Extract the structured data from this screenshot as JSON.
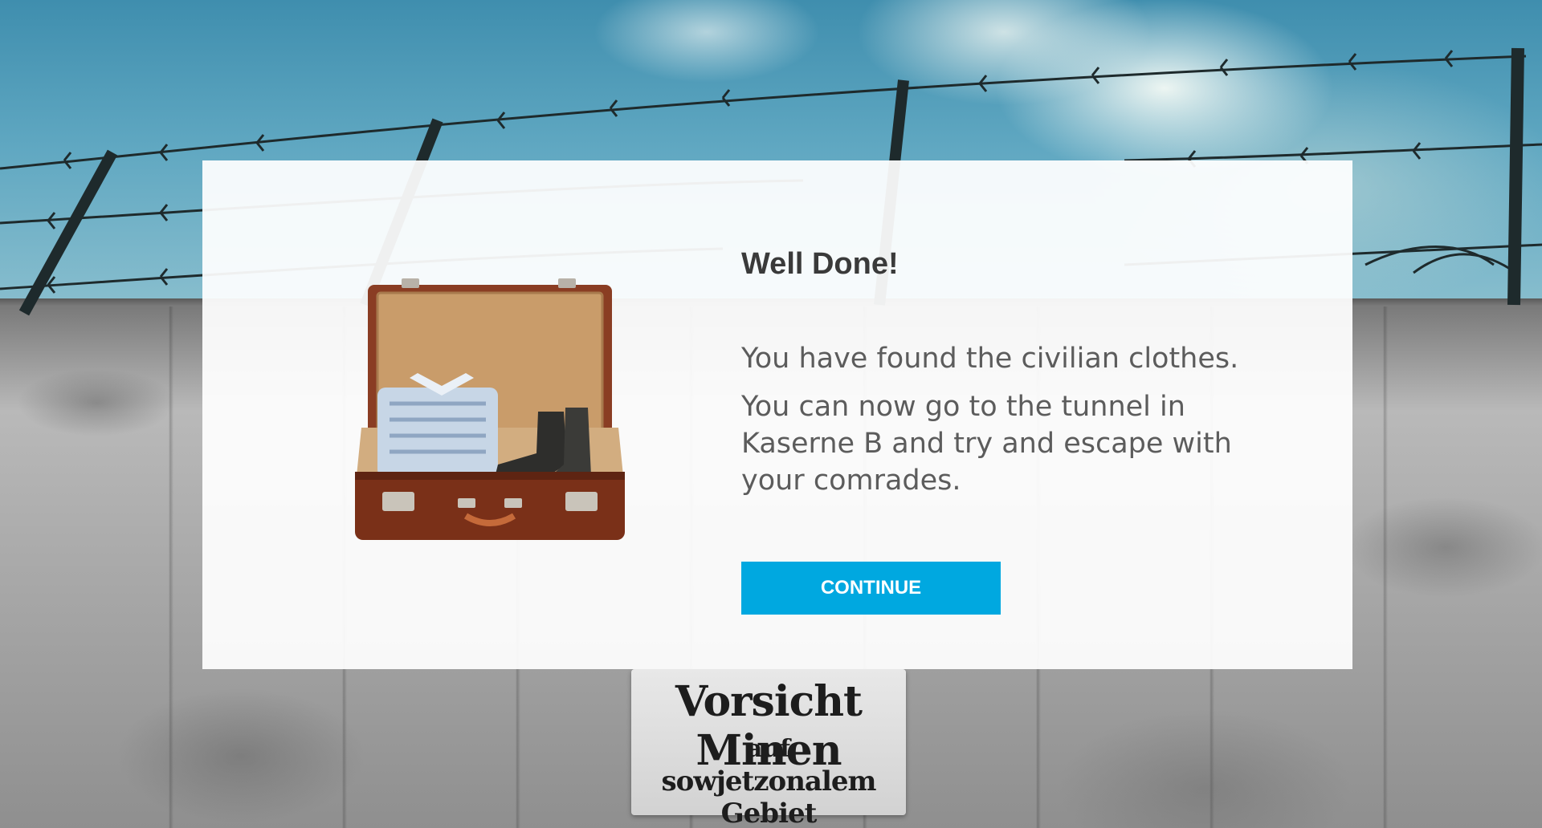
{
  "dialog": {
    "title": "Well Done!",
    "message_line1": "You have found the civilian clothes.",
    "message_line2": "You can now go to the tunnel in Kaserne B and try and escape with your comrades.",
    "continue_label": "CONTINUE",
    "accent_color": "#00a8e0"
  },
  "sign": {
    "line1": "Vorsicht Minen",
    "line2": "auf",
    "line3": "sowjetzonalem Gebiet"
  }
}
